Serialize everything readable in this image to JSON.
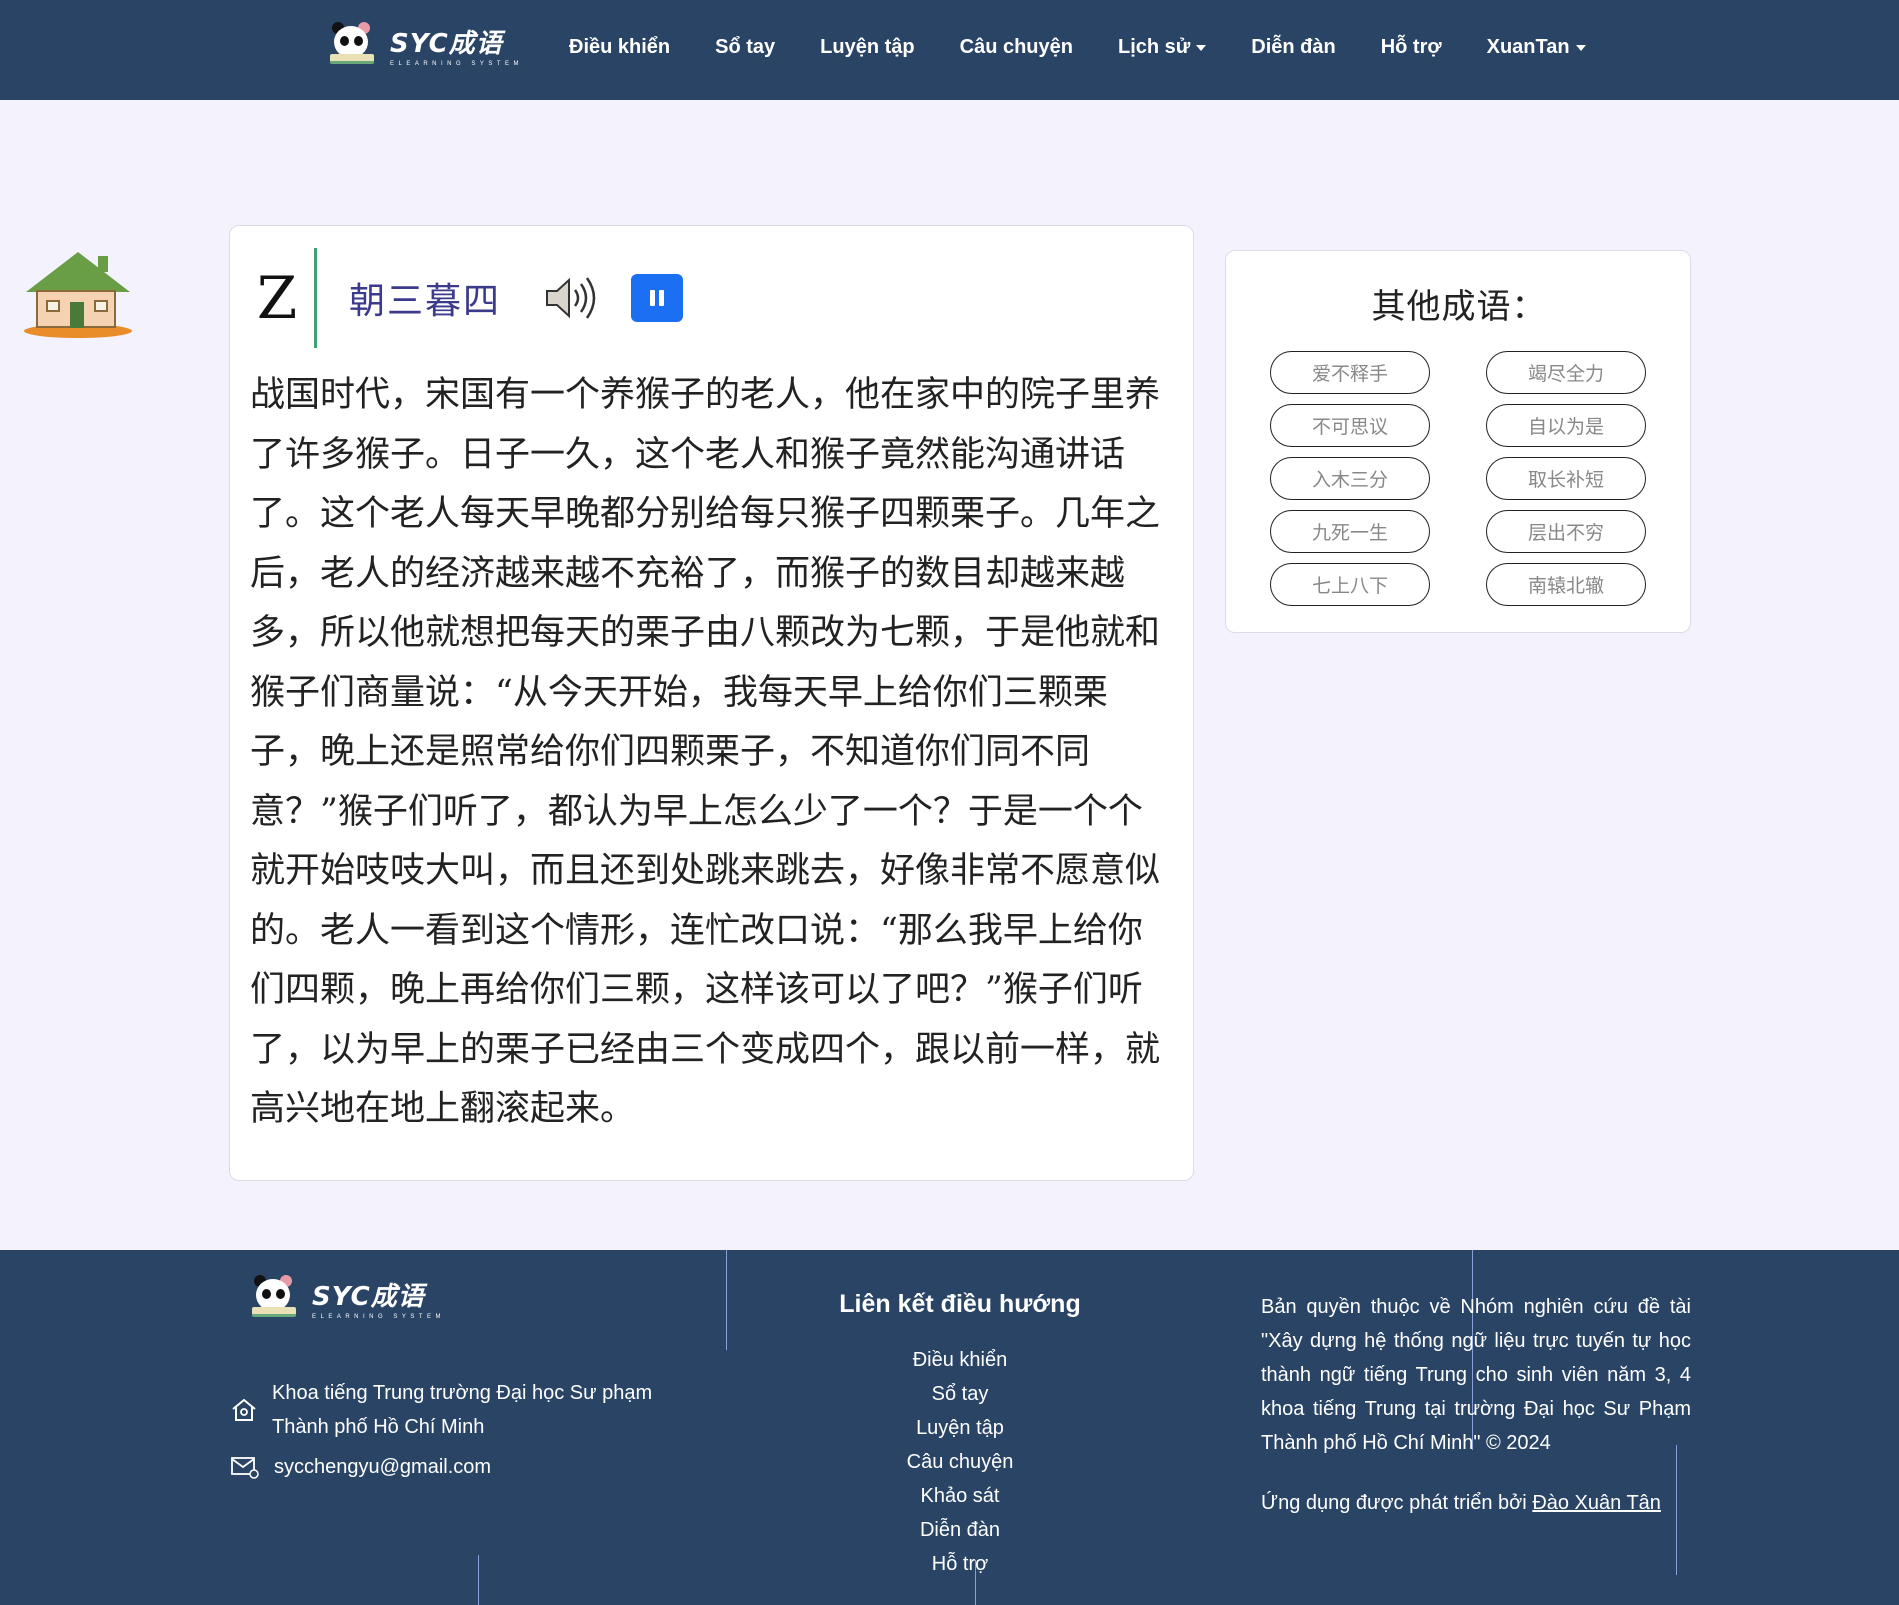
{
  "navbar": {
    "logo_text": "SYC成语",
    "logo_sub": "ELEARNING SYSTEM",
    "links": [
      "Điều khiển",
      "Sổ tay",
      "Luyện tập",
      "Câu chuyện",
      "Lịch sử",
      "Diễn đàn",
      "Hỗ trợ",
      "XuanTan"
    ]
  },
  "story": {
    "letter": "Z",
    "title": "朝三暮四",
    "text": "战国时代，宋国有一个养猴子的老人，他在家中的院子里养了许多猴子。日子一久，这个老人和猴子竟然能沟通讲话了。这个老人每天早晚都分别给每只猴子四颗栗子。几年之后，老人的经济越来越不充裕了，而猴子的数目却越来越多，所以他就想把每天的栗子由八颗改为七颗，于是他就和猴子们商量说：“从今天开始，我每天早上给你们三颗栗子，晚上还是照常给你们四颗栗子，不知道你们同不同意？”猴子们听了，都认为早上怎么少了一个？于是一个个就开始吱吱大叫，而且还到处跳来跳去，好像非常不愿意似的。老人一看到这个情形，连忙改口说：“那么我早上给你们四颗，晚上再给你们三颗，这样该可以了吧？”猴子们听了，以为早上的栗子已经由三个变成四个，跟以前一样，就高兴地在地上翻滚起来。"
  },
  "other": {
    "title": "其他成语：",
    "idioms": [
      "爱不释手",
      "竭尽全力",
      "不可思议",
      "自以为是",
      "入木三分",
      "取长补短",
      "九死一生",
      "层出不穷",
      "七上八下",
      "南辕北辙"
    ]
  },
  "footer": {
    "logo_text": "SYC成语",
    "logo_sub": "ELEARNING SYSTEM",
    "address": [
      "Khoa tiếng Trung trường Đại học Sư phạm",
      "Thành phố Hồ Chí Minh"
    ],
    "email": "sycchengyu@gmail.com",
    "nav_title": "Liên kết điều hướng",
    "nav_links": [
      "Điều khiển",
      "Sổ tay",
      "Luyện tập",
      "Câu chuyện",
      "Khảo sát",
      "Diễn đàn",
      "Hỗ trợ"
    ],
    "copyright": "Bản quyền thuộc về Nhóm nghiên cứu đề tài \"Xây dựng hệ thống ngữ liệu trực tuyến tự học thành ngữ tiếng Trung cho sinh viên năm 3, 4 khoa tiếng Trung tại trường Đại học Sư Phạm Thành phố Hồ Chí Minh\" © 2024",
    "dev_prefix": "Ứng dụng được phát triển bởi ",
    "dev_name": "Đào Xuân Tân"
  },
  "colors": {
    "navbar_bg": "#2a4466",
    "page_bg": "#f4f3fd",
    "title_purple": "#3c3a8a",
    "accent_green": "#3fa075",
    "button_blue": "#1a6ff2"
  }
}
